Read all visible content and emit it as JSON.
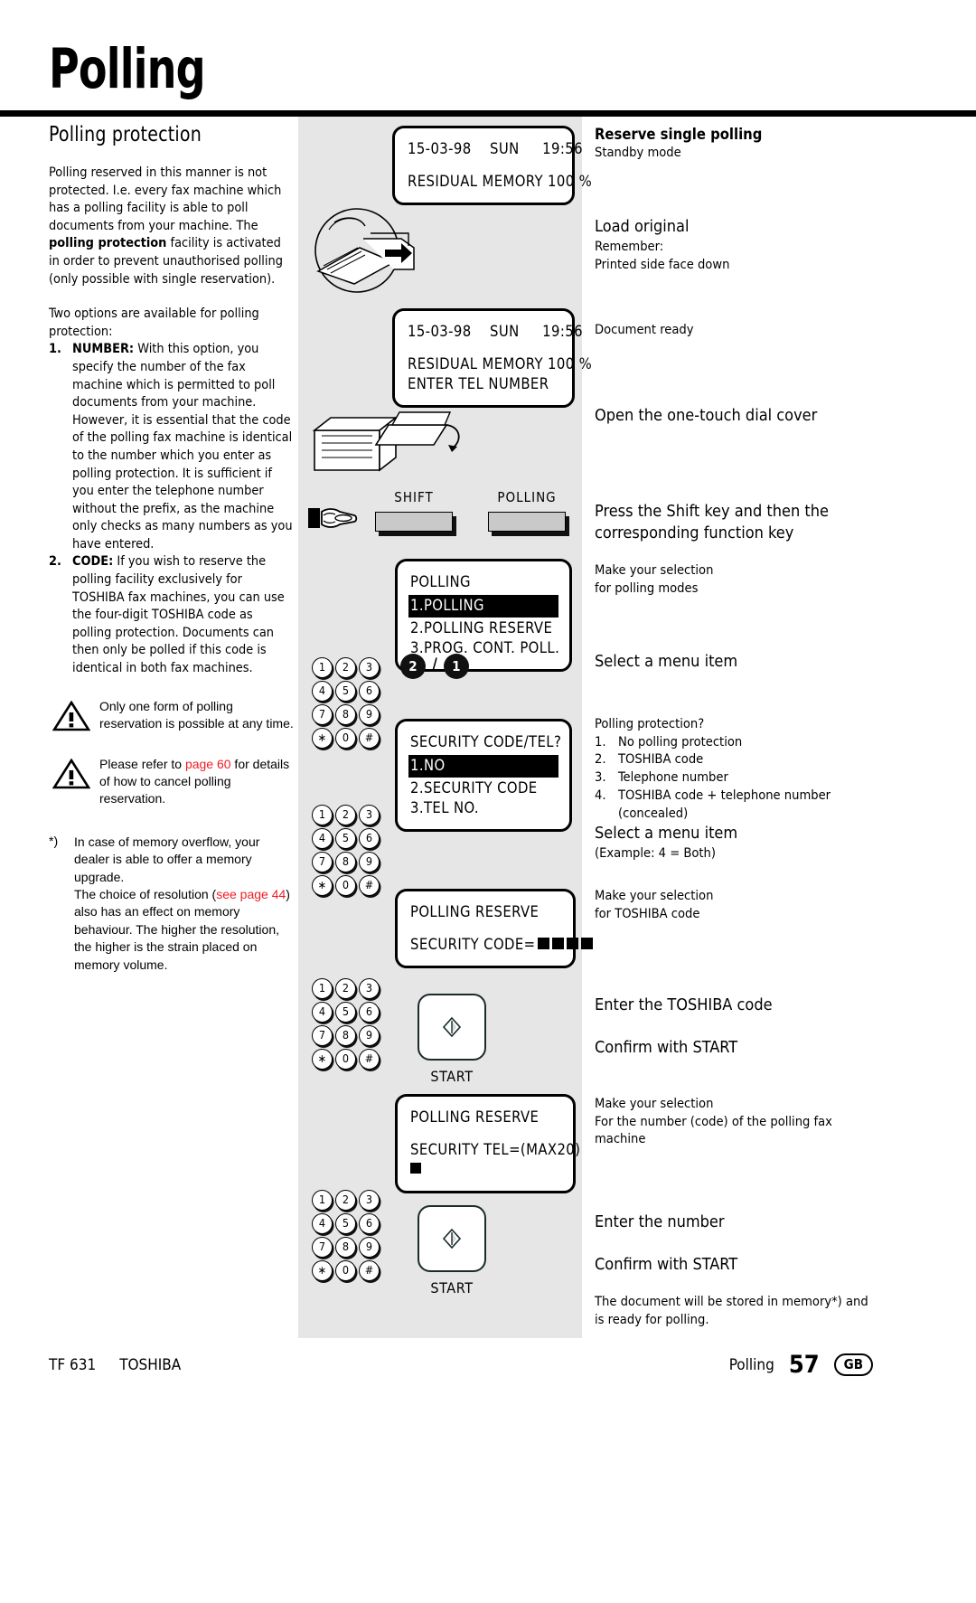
{
  "page": {
    "title": "Polling",
    "section_heading": "Polling protection"
  },
  "left_column": {
    "intro_paragraph_html": "Polling reserved in this manner is not protected. I.e. every fax machine which has a polling facility is able to poll documents from your machine. The <b>polling protection</b> facility is activated in order to prevent unauthorised polling (only possible with single reservation).",
    "options_lead": "Two options are available for polling protection:",
    "options": [
      {
        "number": "1.",
        "label": "NUMBER:",
        "text": " With this option, you specify the number of the fax machine which is permitted to poll documents from your machine. However, it is essential that the code of the polling fax machine is identical to the number which you enter as polling protection. It is sufficient if you enter the telephone number without the prefix, as the machine only checks as many numbers as you have entered."
      },
      {
        "number": "2.",
        "label": "CODE:",
        "text": " If you wish to reserve the polling facility exclusively for TOSHIBA fax machines, you can use the four-digit TOSHIBA code as polling protection. Documents can then only be polled if this code is identical in both fax machines."
      }
    ],
    "warnings": [
      {
        "text": "Only one form of polling reservation is possible at any time."
      },
      {
        "pre": "Please refer to ",
        "link": "page 60",
        "post": " for details of how to cancel polling reservation."
      }
    ],
    "footnote": {
      "marker": "*)",
      "part1": "In case of memory overflow, your dealer is able to offer a memory upgrade.",
      "part2_pre": "The choice of resolution (",
      "part2_link": "see page 44",
      "part2_post": ") also has an effect on memory behaviour. The higher the resolution, the higher is the strain placed on memory volume."
    }
  },
  "center_column": {
    "lcd1": {
      "line1": "15-03-98    SUN     19:56",
      "line2": "RESIDUAL MEMORY 100 %"
    },
    "lcd2": {
      "line1": "15-03-98    SUN     19:56",
      "line2": "RESIDUAL MEMORY 100 %",
      "line3": "ENTER TEL NUMBER"
    },
    "function_keys": [
      {
        "label": "SHIFT"
      },
      {
        "label": "POLLING"
      }
    ],
    "lcd3": {
      "title": "POLLING",
      "highlighted": "1.POLLING",
      "item2": "2.POLLING RESERVE",
      "item3": "3.PROG. CONT. POLL."
    },
    "selection1": {
      "first": "2",
      "separator": "/",
      "second": "1"
    },
    "lcd4": {
      "title": "SECURITY CODE/TEL?",
      "highlighted": "1.NO",
      "item2": "2.SECURITY CODE",
      "item3": "3.TEL NO."
    },
    "lcd5": {
      "line1": "POLLING RESERVE",
      "line2": "SECURITY CODE="
    },
    "lcd6": {
      "line1": "POLLING RESERVE",
      "line2": "SECURITY TEL=(MAX20)"
    },
    "keypad_keys": [
      "1",
      "2",
      "3",
      "4",
      "5",
      "6",
      "7",
      "8",
      "9",
      "∗",
      "0",
      "#"
    ],
    "start_buttons": [
      {
        "label": "START"
      },
      {
        "label": "START"
      }
    ]
  },
  "right_column": {
    "blocks": [
      {
        "head": "Reserve single polling",
        "head_bold": true,
        "sub": "Standby mode"
      },
      {
        "head": "Load original",
        "head_bold": false,
        "sub": "Remember:\nPrinted side face down"
      },
      {
        "head": "",
        "head_bold": false,
        "sub": "Document ready"
      },
      {
        "head": "Open the one-touch dial cover",
        "head_bold": false,
        "sub": ""
      },
      {
        "head": "Press the Shift key and then the corresponding function key",
        "head_bold": false,
        "sub": ""
      },
      {
        "head": "",
        "head_bold": false,
        "sub": "Make your selection\nfor polling modes"
      },
      {
        "head": "Select a menu item",
        "head_bold": false,
        "sub": ""
      },
      {
        "head": "",
        "head_bold": false,
        "sub": "Polling protection?"
      },
      {
        "head": "Select a menu item",
        "head_bold": false,
        "sub": "(Example: 4 = Both)"
      },
      {
        "head": "",
        "head_bold": false,
        "sub": "Make your selection\nfor TOSHIBA code"
      },
      {
        "head": "Enter the TOSHIBA code",
        "head_bold": false,
        "sub": ""
      },
      {
        "head": "Confirm with START",
        "head_bold": false,
        "sub": ""
      },
      {
        "head": "",
        "head_bold": false,
        "sub": "Make your selection\nFor the number (code) of the polling fax machine"
      },
      {
        "head": "Enter the number",
        "head_bold": false,
        "sub": ""
      },
      {
        "head": "Confirm with START",
        "head_bold": false,
        "sub": ""
      },
      {
        "head": "",
        "head_bold": false,
        "sub": "The document will be stored in memory*) and is ready for polling."
      }
    ],
    "protection_options": [
      {
        "n": "1.",
        "t": "No polling protection"
      },
      {
        "n": "2.",
        "t": "TOSHIBA code"
      },
      {
        "n": "3.",
        "t": "Telephone number"
      },
      {
        "n": "4.",
        "t": "TOSHIBA code + telephone number (concealed)"
      }
    ]
  },
  "footer": {
    "model": "TF 631",
    "brand": "TOSHIBA",
    "section": "Polling",
    "page_number": "57",
    "region": "GB"
  },
  "colors": {
    "accent_red": "#ee1c25",
    "panel_gray": "#e6e6e6",
    "key_gray": "#c9c9c9"
  }
}
